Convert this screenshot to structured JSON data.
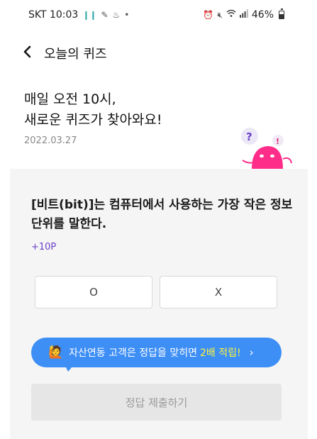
{
  "status_bar": {
    "carrier_time": "SKT 10:03",
    "left_icons": [
      "footsteps-icon",
      "sticker-icon",
      "care-icon",
      "dot-icon"
    ],
    "right_icons": [
      "alarm-icon",
      "mute-icon",
      "wifi-icon",
      "signal-icon"
    ],
    "battery": "46%"
  },
  "header": {
    "title": "오늘의 퀴즈"
  },
  "intro": {
    "line1": "매일 오전 10시,",
    "line2": "새로운 퀴즈가 찾아와요!",
    "date": "2022.03.27"
  },
  "quiz": {
    "question_line1": "[비트(bit)]는 컴퓨터에서 사용하는 가장 작은 정보",
    "question_line2": "단위를 말한다.",
    "points": "+10P",
    "answers": [
      "O",
      "X"
    ]
  },
  "promo": {
    "text": "자산연동 고객은 정답을 맞히면",
    "highlight": "2배 적립!",
    "chevron": "›"
  },
  "submit": {
    "label": "정답 제출하기"
  },
  "colors": {
    "accent_purple": "#6b3fc8",
    "promo_blue": "#3d8ef5",
    "promo_highlight": "#fff53b",
    "mascot_pink": "#ff2d8a"
  }
}
